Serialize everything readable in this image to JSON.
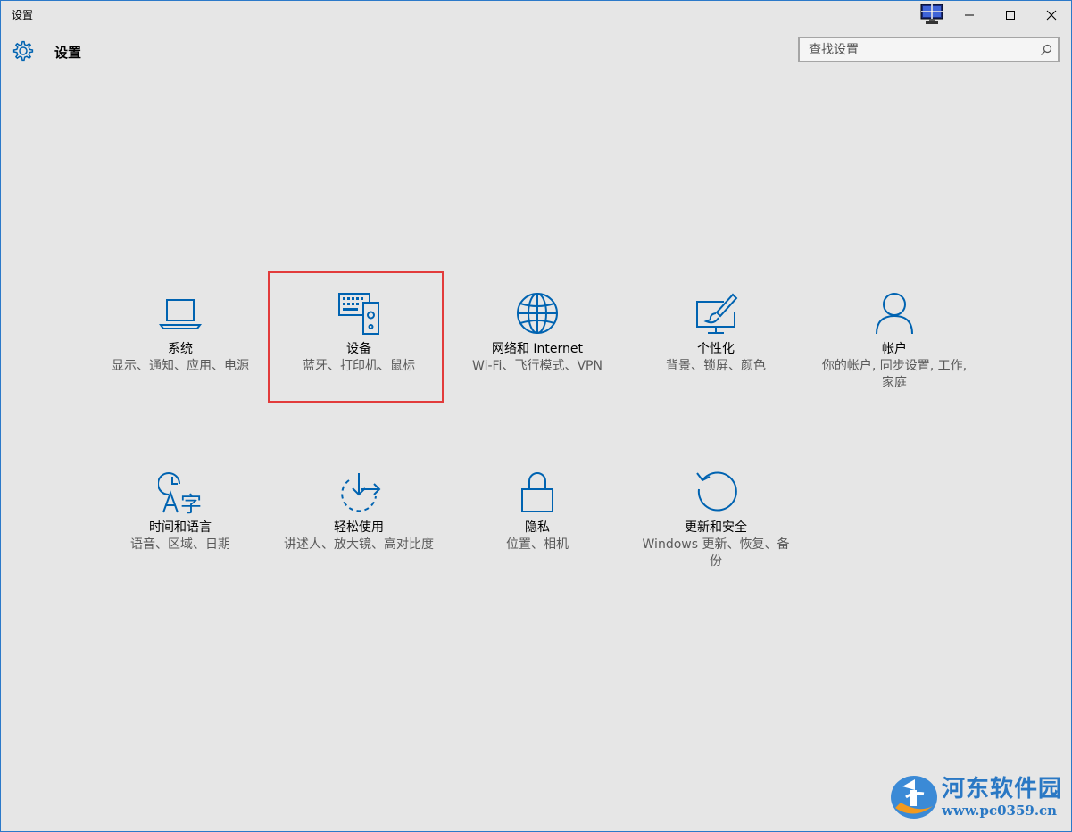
{
  "window": {
    "title": "设置",
    "minimize_icon": "minimize-icon",
    "maximize_icon": "maximize-icon",
    "close_icon": "close-icon"
  },
  "header": {
    "title": "设置",
    "icon": "gear-icon"
  },
  "search": {
    "placeholder": "查找设置",
    "icon": "search-icon"
  },
  "colors": {
    "accent": "#0063b1",
    "highlight": "#e23b3b",
    "background": "#e6e6e6"
  },
  "tiles": [
    {
      "name": "系统",
      "desc": "显示、通知、应用、电源",
      "icon": "laptop-icon"
    },
    {
      "name": "设备",
      "desc": "蓝牙、打印机、鼠标",
      "icon": "devices-icon"
    },
    {
      "name": "网络和 Internet",
      "desc": "Wi-Fi、飞行模式、VPN",
      "icon": "globe-icon"
    },
    {
      "name": "个性化",
      "desc": "背景、锁屏、颜色",
      "icon": "personalization-icon"
    },
    {
      "name": "帐户",
      "desc": "你的帐户, 同步设置, 工作, 家庭",
      "icon": "person-icon"
    },
    {
      "name": "时间和语言",
      "desc": "语音、区域、日期",
      "icon": "time-language-icon"
    },
    {
      "name": "轻松使用",
      "desc": "讲述人、放大镜、高对比度",
      "icon": "ease-of-access-icon"
    },
    {
      "name": "隐私",
      "desc": "位置、相机",
      "icon": "lock-icon"
    },
    {
      "name": "更新和安全",
      "desc": "Windows 更新、恢复、备份",
      "icon": "update-icon"
    }
  ],
  "watermark": {
    "name": "河东软件园",
    "url": "www.pc0359.cn"
  }
}
